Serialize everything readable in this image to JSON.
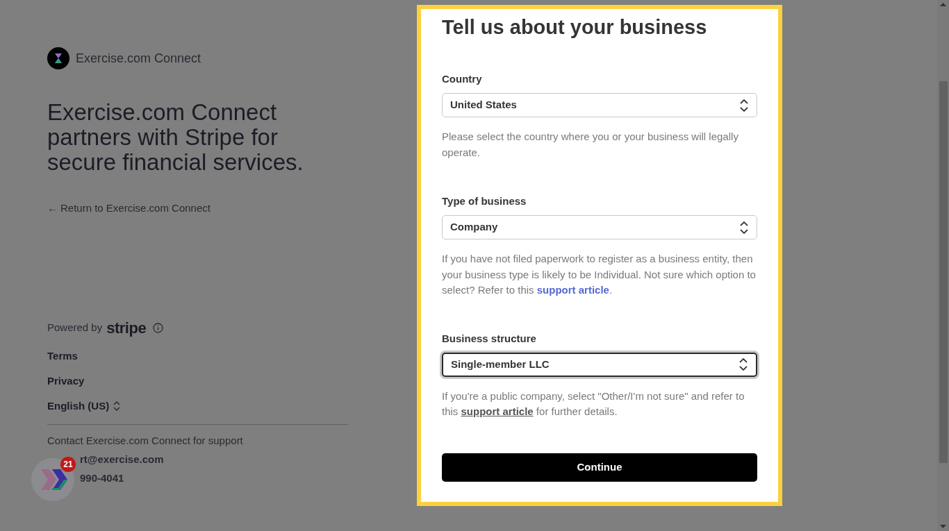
{
  "brand": {
    "name": "Exercise.com Connect"
  },
  "headline": "Exercise.com Connect partners with Stripe for secure financial services.",
  "return_link": {
    "arrow": "←",
    "label": "Return to Exercise.com Connect"
  },
  "powered_by": {
    "label": "Powered by",
    "logo_text": "stripe"
  },
  "footer_links": [
    {
      "label": "Terms",
      "kind": "link"
    },
    {
      "label": "Privacy",
      "kind": "link"
    },
    {
      "label": "English (US)",
      "kind": "language"
    }
  ],
  "contact": {
    "title": "Contact Exercise.com Connect for support",
    "email": "rt@exercise.com",
    "phone": "990-4041"
  },
  "widget": {
    "badge": "21"
  },
  "form": {
    "title": "Tell us about your business",
    "fields": [
      {
        "label": "Country",
        "value": "United States",
        "focused": false,
        "help": {
          "before": "Please select the country where you or your business will legally operate."
        }
      },
      {
        "label": "Type of business",
        "value": "Company",
        "focused": false,
        "help": {
          "before": "If you have not filed paperwork to register as a business entity, then your business type is likely to be Individual. Not sure which option to select? Refer to this ",
          "link": {
            "text": "support article",
            "kind": "accent"
          },
          "after": "."
        }
      },
      {
        "label": "Business structure",
        "value": "Single-member LLC",
        "focused": true,
        "help": {
          "before": "If you're a public company, select \"Other/I'm not sure\" and refer to this ",
          "link": {
            "text": "support article",
            "kind": "underlined"
          },
          "after": " for further details."
        }
      }
    ],
    "submit": "Continue"
  }
}
